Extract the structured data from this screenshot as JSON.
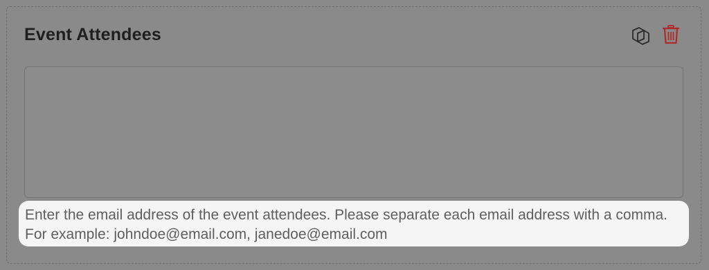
{
  "field": {
    "title": "Event Attendees",
    "value": "",
    "help_text": "Enter the email address of the event attendees. Please separate each email address with a comma. For example: johndoe@email.com, janedoe@email.com"
  },
  "actions": {
    "duplicate_icon": "duplicate-icon",
    "delete_icon": "trash-icon"
  },
  "colors": {
    "background": "#8a8a8a",
    "delete": "#b02a2a",
    "help_background": "#f5f5f5"
  }
}
